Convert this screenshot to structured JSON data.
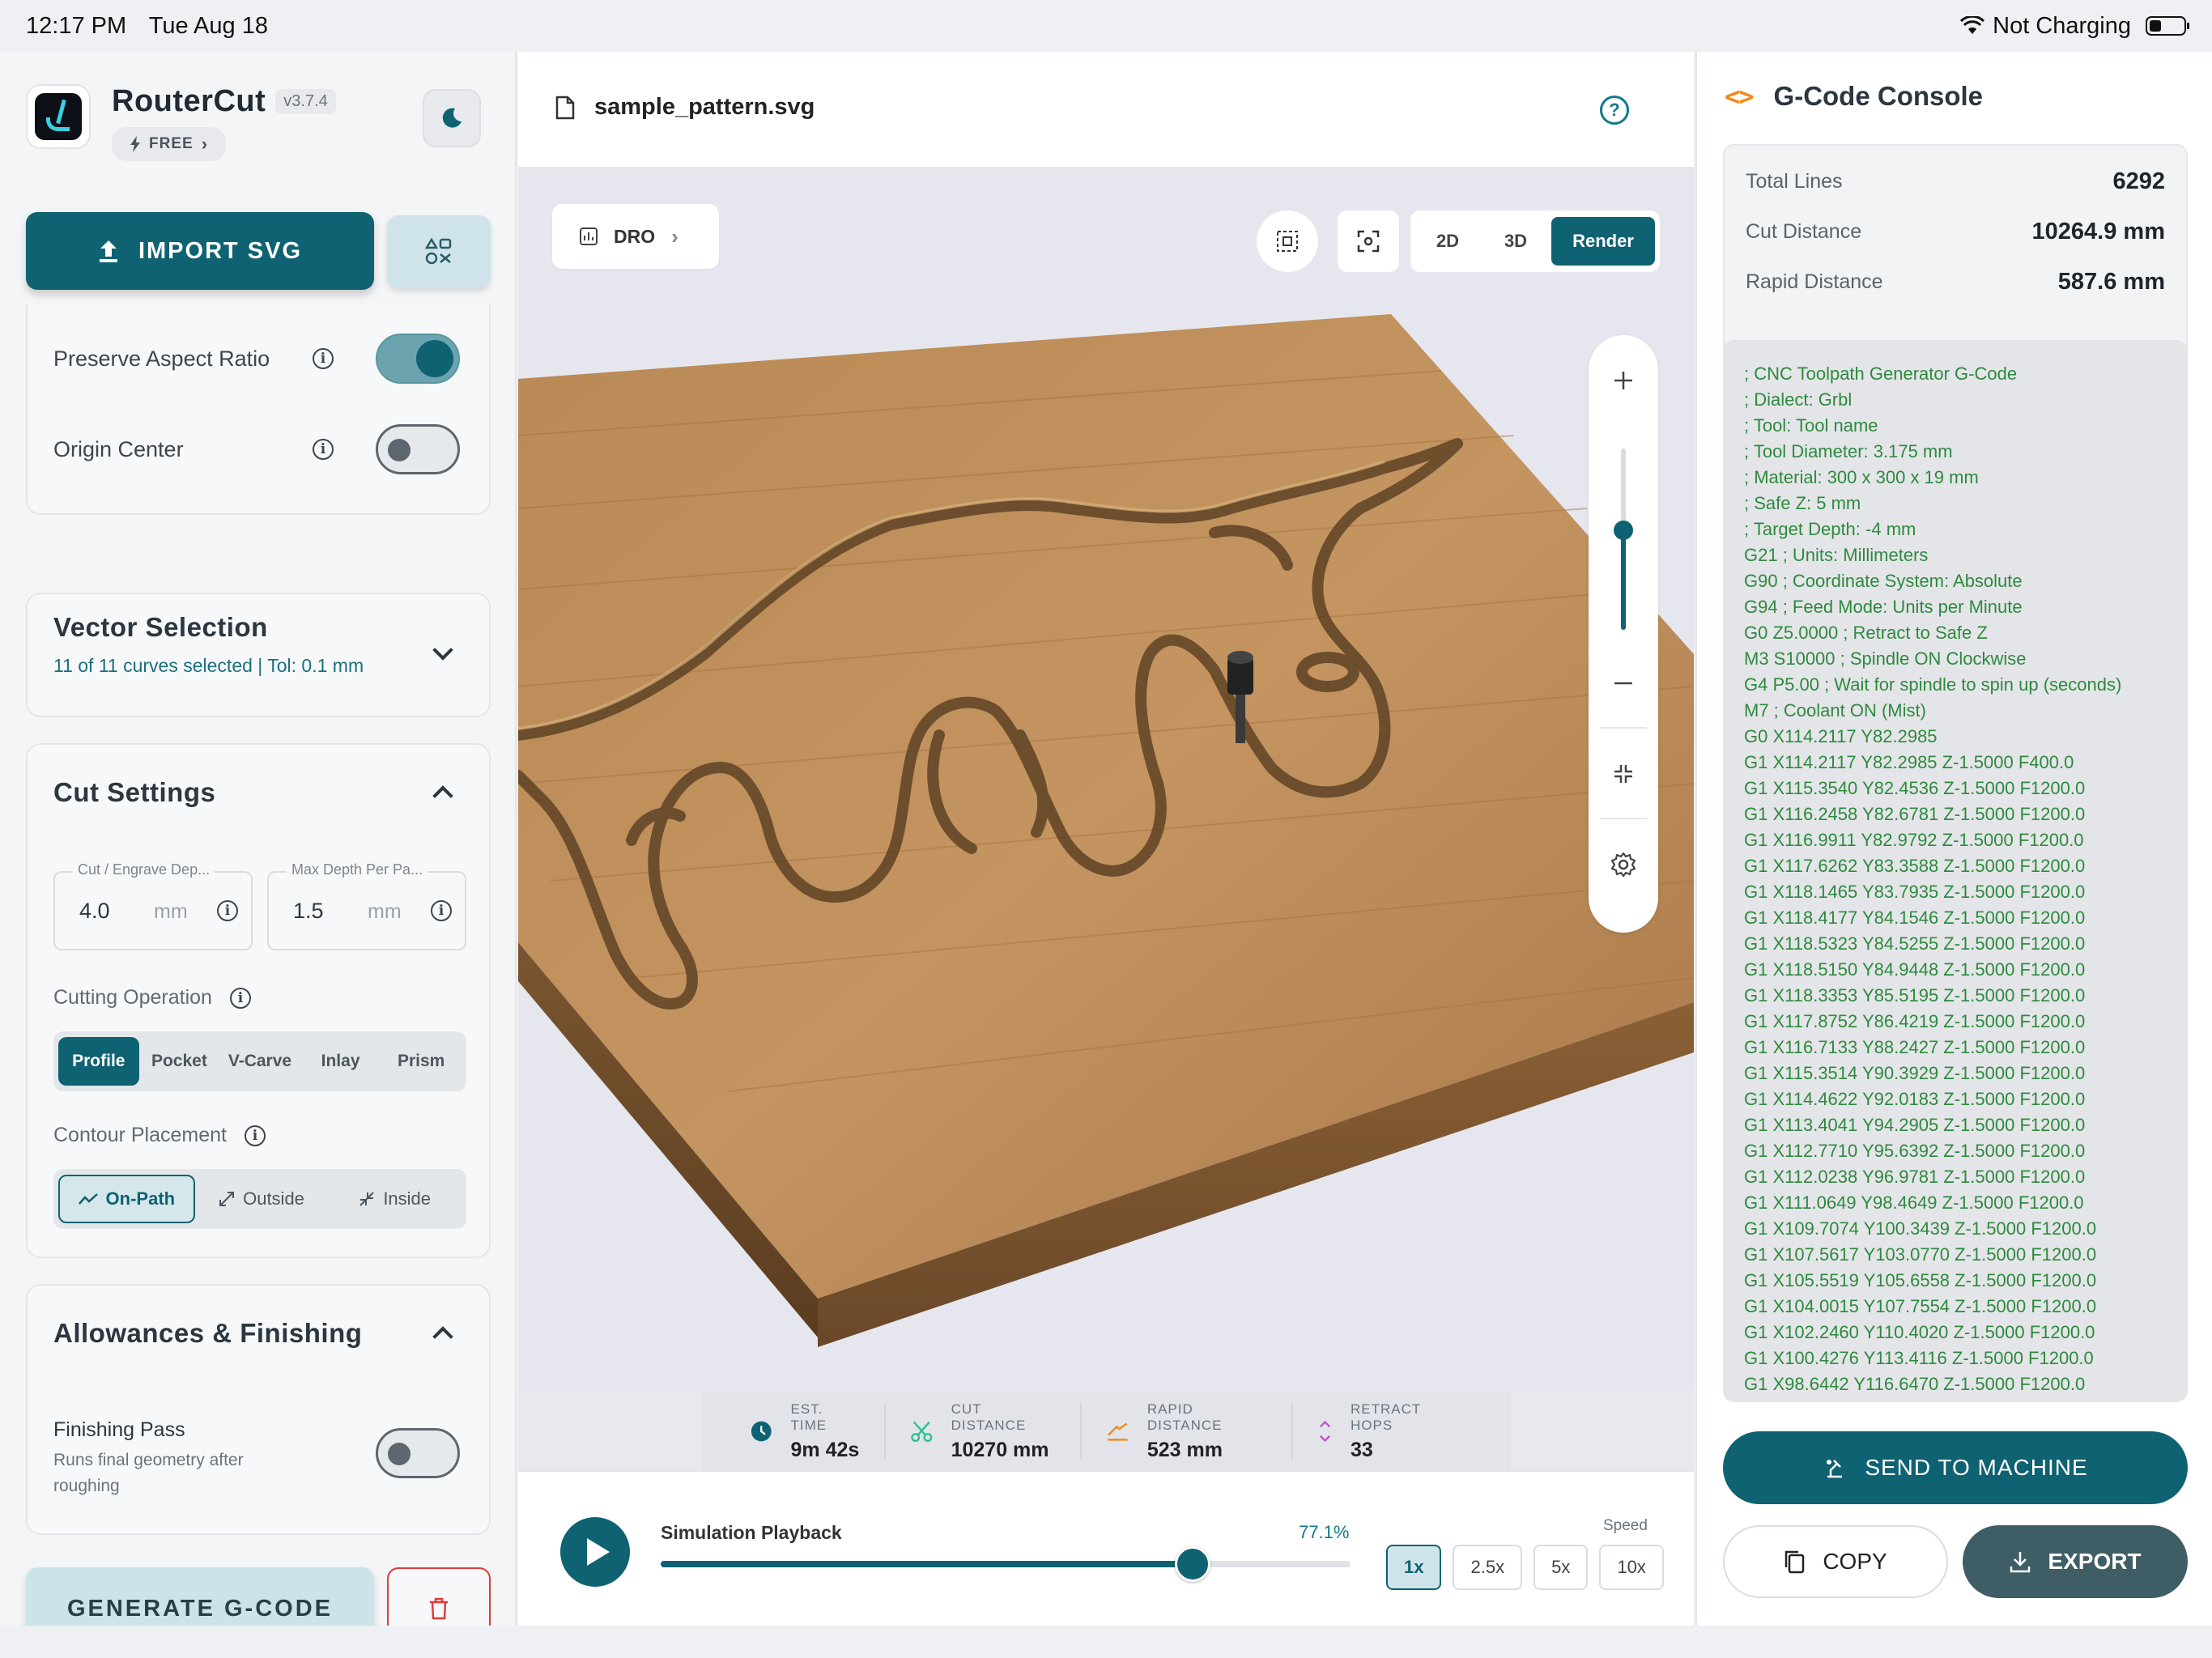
{
  "status_bar": {
    "time": "12:17 PM",
    "date": "Tue Aug 18",
    "battery_text": "Not Charging",
    "icons": [
      "wifi-icon",
      "battery-icon"
    ]
  },
  "app": {
    "name": "RouterCut",
    "version": "v3.7.4",
    "plan": "FREE",
    "icons": [
      "app-logo",
      "bolt-icon",
      "moon-icon"
    ]
  },
  "sidebar": {
    "import_label": "IMPORT SVG",
    "preserve_aspect": {
      "label": "Preserve Aspect Ratio",
      "on": true
    },
    "origin_center": {
      "label": "Origin Center",
      "on": false
    },
    "vector_selection": {
      "title": "Vector Selection",
      "subtitle": "11 of 11 curves selected | Tol: 0.1 mm"
    },
    "cut_settings": {
      "title": "Cut Settings",
      "cut_depth": {
        "label": "Cut / Engrave Dep...",
        "value": "4.0",
        "unit": "mm"
      },
      "max_depth": {
        "label": "Max Depth Per Pa...",
        "value": "1.5",
        "unit": "mm"
      },
      "cutting_operation_label": "Cutting Operation",
      "operations": [
        "Profile",
        "Pocket",
        "V-Carve",
        "Inlay",
        "Prism"
      ],
      "operation_selected": "Profile",
      "contour_label": "Contour Placement",
      "contours": [
        "On-Path",
        "Outside",
        "Inside"
      ],
      "contour_selected": "On-Path"
    },
    "allowances": {
      "title": "Allowances & Finishing",
      "finishing_title": "Finishing Pass",
      "finishing_sub": "Runs final geometry after roughing",
      "finishing_on": false
    },
    "generate_label": "GENERATE G-CODE"
  },
  "center": {
    "file_name": "sample_pattern.svg",
    "dro_label": "DRO",
    "view_modes": [
      "2D",
      "3D",
      "Render"
    ],
    "view_selected": "Render",
    "zoom_level": 0.55,
    "stats": [
      {
        "label": "EST. TIME",
        "value": "9m 42s",
        "icon": "clock-icon",
        "color": "#0e6272"
      },
      {
        "label": "CUT DISTANCE",
        "value": "10270 mm",
        "icon": "scissors-icon",
        "color": "#2fbf8f"
      },
      {
        "label": "RAPID DISTANCE",
        "value": "523 mm",
        "icon": "rapid-icon",
        "color": "#f08a1c"
      },
      {
        "label": "RETRACT HOPS",
        "value": "33",
        "icon": "retract-icon",
        "color": "#c24fd0"
      }
    ],
    "playback": {
      "title": "Simulation Playback",
      "percent_text": "77.1%",
      "progress": 0.771,
      "speed_label": "Speed",
      "speeds": [
        "1x",
        "2.5x",
        "5x",
        "10x"
      ],
      "speed_selected": "1x"
    }
  },
  "console": {
    "title": "G-Code Console",
    "summary": [
      {
        "label": "Total Lines",
        "value": "6292"
      },
      {
        "label": "Cut Distance",
        "value": "10264.9 mm"
      },
      {
        "label": "Rapid Distance",
        "value": "587.6 mm"
      }
    ],
    "lines": [
      "; CNC Toolpath Generator G-Code",
      "; Dialect: Grbl",
      "; Tool: Tool name",
      "; Tool Diameter: 3.175 mm",
      "; Material: 300 x 300 x 19 mm",
      "; Safe Z: 5 mm",
      "; Target Depth: -4 mm",
      "G21 ; Units: Millimeters",
      "G90 ; Coordinate System: Absolute",
      "G94 ; Feed Mode: Units per Minute",
      "G0 Z5.0000 ; Retract to Safe Z",
      "M3 S10000 ; Spindle ON Clockwise",
      "G4 P5.00 ; Wait for spindle to spin up (seconds)",
      "M7 ; Coolant ON (Mist)",
      "G0 X114.2117 Y82.2985",
      "G1 X114.2117 Y82.2985 Z-1.5000 F400.0",
      "G1 X115.3540 Y82.4536 Z-1.5000 F1200.0",
      "G1 X116.2458 Y82.6781 Z-1.5000 F1200.0",
      "G1 X116.9911 Y82.9792 Z-1.5000 F1200.0",
      "G1 X117.6262 Y83.3588 Z-1.5000 F1200.0",
      "G1 X118.1465 Y83.7935 Z-1.5000 F1200.0",
      "G1 X118.4177 Y84.1546 Z-1.5000 F1200.0",
      "G1 X118.5323 Y84.5255 Z-1.5000 F1200.0",
      "G1 X118.5150 Y84.9448 Z-1.5000 F1200.0",
      "G1 X118.3353 Y85.5195 Z-1.5000 F1200.0",
      "G1 X117.8752 Y86.4219 Z-1.5000 F1200.0",
      "G1 X116.7133 Y88.2427 Z-1.5000 F1200.0",
      "G1 X115.3514 Y90.3929 Z-1.5000 F1200.0",
      "G1 X114.4622 Y92.0183 Z-1.5000 F1200.0",
      "G1 X113.4041 Y94.2905 Z-1.5000 F1200.0",
      "G1 X112.7710 Y95.6392 Z-1.5000 F1200.0",
      "G1 X112.0238 Y96.9781 Z-1.5000 F1200.0",
      "G1 X111.0649 Y98.4649 Z-1.5000 F1200.0",
      "G1 X109.7074 Y100.3439 Z-1.5000 F1200.0",
      "G1 X107.5617 Y103.0770 Z-1.5000 F1200.0",
      "G1 X105.5519 Y105.6558 Z-1.5000 F1200.0",
      "G1 X104.0015 Y107.7554 Z-1.5000 F1200.0",
      "G1 X102.2460 Y110.4020 Z-1.5000 F1200.0",
      "G1 X100.4276 Y113.4116 Z-1.5000 F1200.0",
      "G1 X98.6442 Y116.6470 Z-1.5000 F1200.0"
    ],
    "send_label": "SEND TO MACHINE",
    "copy_label": "COPY",
    "export_label": "EXPORT"
  }
}
